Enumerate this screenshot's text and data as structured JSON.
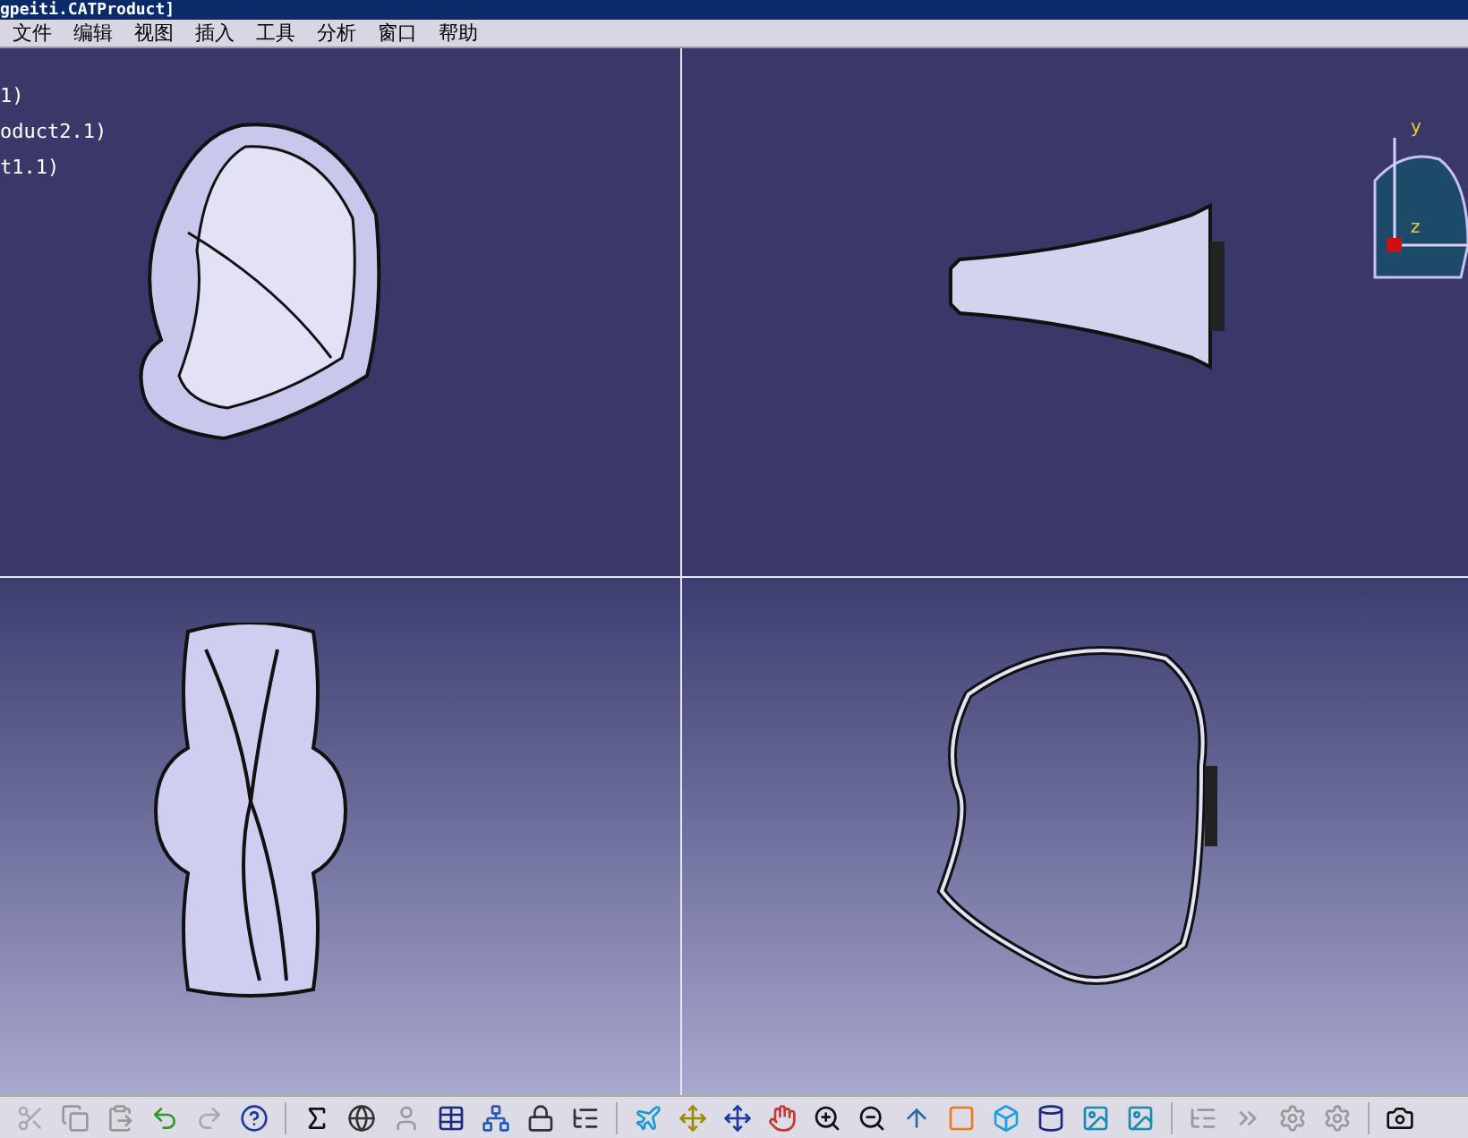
{
  "window": {
    "title": "gpeiti.CATProduct]"
  },
  "menu": [
    "文件",
    "编辑",
    "视图",
    "插入",
    "工具",
    "分析",
    "窗口",
    "帮助"
  ],
  "tree": [
    "1)",
    "oduct2.1)",
    "t1.1)"
  ],
  "compass": {
    "axis_y": "y",
    "axis_z": "z"
  }
}
